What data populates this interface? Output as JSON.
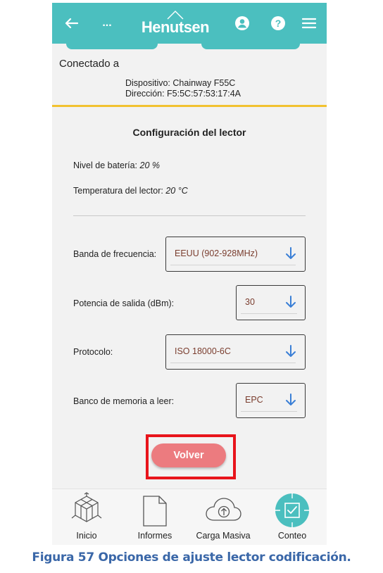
{
  "header": {
    "more_label": "...",
    "logo_text": "Henutsen"
  },
  "connection": {
    "title": "Conectado a",
    "device": "Dispositivo: Chainway F55C",
    "address": "Dirección: F5:5C:57:53:17:4A"
  },
  "config": {
    "title": "Configuración del lector",
    "battery_label": "Nivel de batería:",
    "battery_value": "20 %",
    "temperature_label": "Temperatura del lector:",
    "temperature_value": "20 °C",
    "fields": [
      {
        "label": "Banda de frecuencia:",
        "value": "EEUU (902-928MHz)"
      },
      {
        "label": "Potencia de salida (dBm):",
        "value": "30"
      },
      {
        "label": "Protocolo:",
        "value": "ISO 18000-6C"
      },
      {
        "label": "Banco de memoria a leer:",
        "value": "EPC"
      }
    ],
    "back_button": "Volver"
  },
  "nav": {
    "items": [
      {
        "label": "Inicio",
        "icon": "cube-icon"
      },
      {
        "label": "Informes",
        "icon": "document-icon"
      },
      {
        "label": "Carga Masiva",
        "icon": "cloud-upload-icon"
      },
      {
        "label": "Conteo",
        "icon": "scan-check-icon"
      }
    ]
  },
  "caption": "Figura 57 Opciones de ajuste lector codificación.",
  "colors": {
    "header": "#4bbfbf",
    "accent_yellow": "#f2c230",
    "button": "#ec7b7f",
    "highlight": "#e8141b",
    "caption": "#3a67a8"
  }
}
